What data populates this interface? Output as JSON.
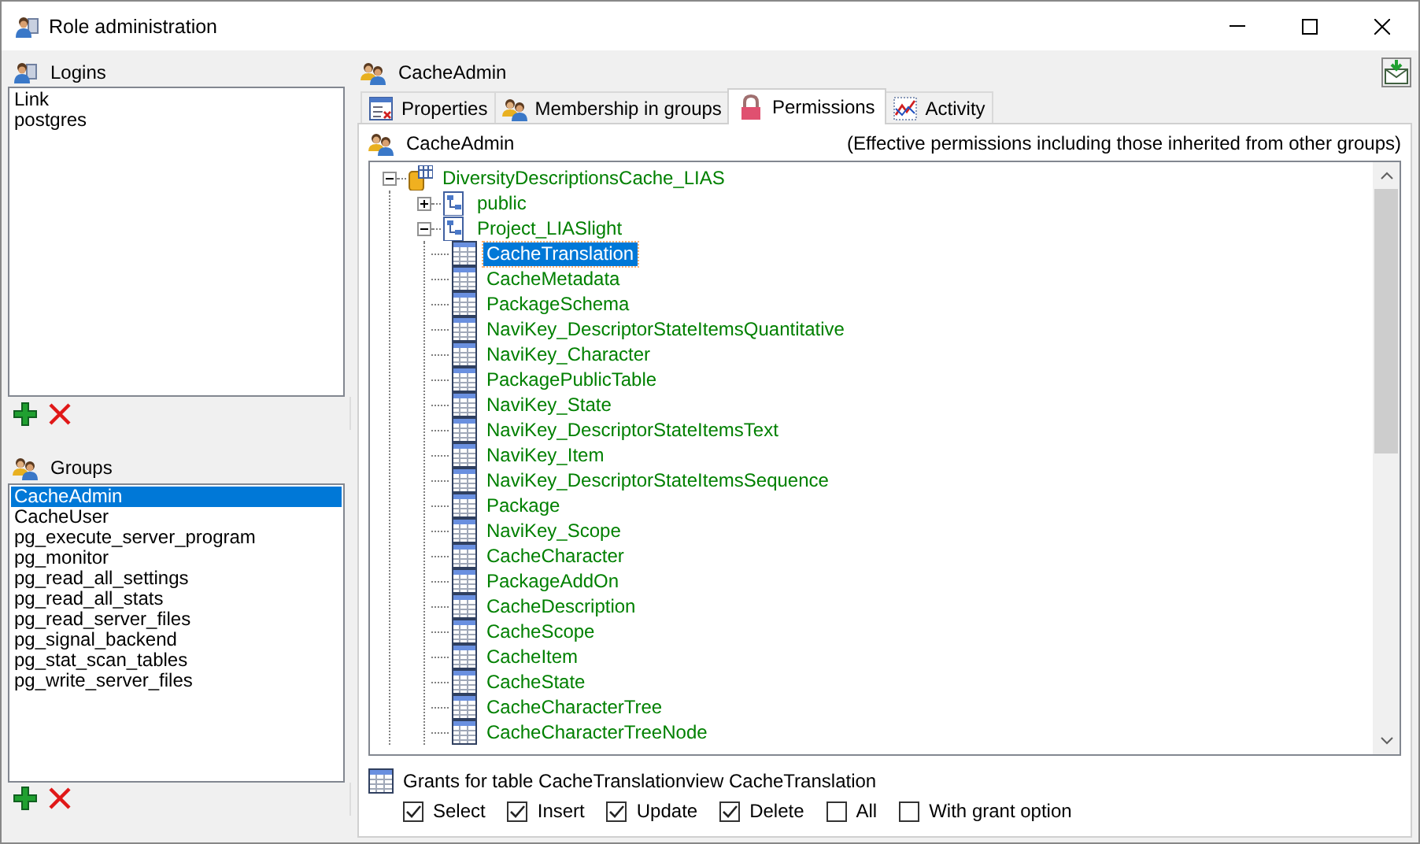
{
  "window": {
    "title": "Role administration"
  },
  "logins": {
    "title": "Logins",
    "items": [
      {
        "label": "Link",
        "selected": false
      },
      {
        "label": "postgres",
        "selected": false
      }
    ]
  },
  "groups": {
    "title": "Groups",
    "items": [
      {
        "label": "CacheAdmin",
        "selected": true
      },
      {
        "label": "CacheUser",
        "selected": false
      },
      {
        "label": "pg_execute_server_program",
        "selected": false
      },
      {
        "label": "pg_monitor",
        "selected": false
      },
      {
        "label": "pg_read_all_settings",
        "selected": false
      },
      {
        "label": "pg_read_all_stats",
        "selected": false
      },
      {
        "label": "pg_read_server_files",
        "selected": false
      },
      {
        "label": "pg_signal_backend",
        "selected": false
      },
      {
        "label": "pg_stat_scan_tables",
        "selected": false
      },
      {
        "label": "pg_write_server_files",
        "selected": false
      }
    ]
  },
  "role": {
    "name": "CacheAdmin"
  },
  "tabs": [
    {
      "label": "Properties",
      "kind": "properties",
      "selected": false
    },
    {
      "label": "Membership in groups",
      "kind": "membership",
      "selected": false
    },
    {
      "label": "Permissions",
      "kind": "permissions",
      "selected": true
    },
    {
      "label": "Activity",
      "kind": "activity",
      "selected": false
    }
  ],
  "permissions": {
    "role": "CacheAdmin",
    "note": "(Effective permissions including those inherited from other groups)",
    "tree": [
      {
        "label": "DiversityDescriptionsCache_LIAS",
        "kind": "database",
        "expanded": true,
        "selected": false,
        "children": [
          {
            "label": "public",
            "kind": "schema",
            "expanded": false,
            "selected": false
          },
          {
            "label": "Project_LIASlight",
            "kind": "schema",
            "expanded": true,
            "selected": false,
            "children": [
              {
                "label": "CacheTranslation",
                "kind": "table",
                "selected": true
              },
              {
                "label": "CacheMetadata",
                "kind": "table",
                "selected": false
              },
              {
                "label": "PackageSchema",
                "kind": "table",
                "selected": false
              },
              {
                "label": "NaviKey_DescriptorStateItemsQuantitative",
                "kind": "table",
                "selected": false
              },
              {
                "label": "NaviKey_Character",
                "kind": "table",
                "selected": false
              },
              {
                "label": "PackagePublicTable",
                "kind": "table",
                "selected": false
              },
              {
                "label": "NaviKey_State",
                "kind": "table",
                "selected": false
              },
              {
                "label": "NaviKey_DescriptorStateItemsText",
                "kind": "table",
                "selected": false
              },
              {
                "label": "NaviKey_Item",
                "kind": "table",
                "selected": false
              },
              {
                "label": "NaviKey_DescriptorStateItemsSequence",
                "kind": "table",
                "selected": false
              },
              {
                "label": "Package",
                "kind": "table",
                "selected": false
              },
              {
                "label": "NaviKey_Scope",
                "kind": "table",
                "selected": false
              },
              {
                "label": "CacheCharacter",
                "kind": "table",
                "selected": false
              },
              {
                "label": "PackageAddOn",
                "kind": "table",
                "selected": false
              },
              {
                "label": "CacheDescription",
                "kind": "table",
                "selected": false
              },
              {
                "label": "CacheScope",
                "kind": "table",
                "selected": false
              },
              {
                "label": "CacheItem",
                "kind": "table",
                "selected": false
              },
              {
                "label": "CacheState",
                "kind": "table",
                "selected": false
              },
              {
                "label": "CacheCharacterTree",
                "kind": "table",
                "selected": false
              },
              {
                "label": "CacheCharacterTreeNode",
                "kind": "table",
                "selected": false
              }
            ]
          }
        ]
      }
    ],
    "grants": {
      "title": "Grants for table CacheTranslationview CacheTranslation",
      "options": [
        {
          "label": "Select",
          "checked": true
        },
        {
          "label": "Insert",
          "checked": true
        },
        {
          "label": "Update",
          "checked": true
        },
        {
          "label": "Delete",
          "checked": true
        },
        {
          "label": "All",
          "checked": false
        },
        {
          "label": "With grant option",
          "checked": false
        }
      ]
    }
  }
}
